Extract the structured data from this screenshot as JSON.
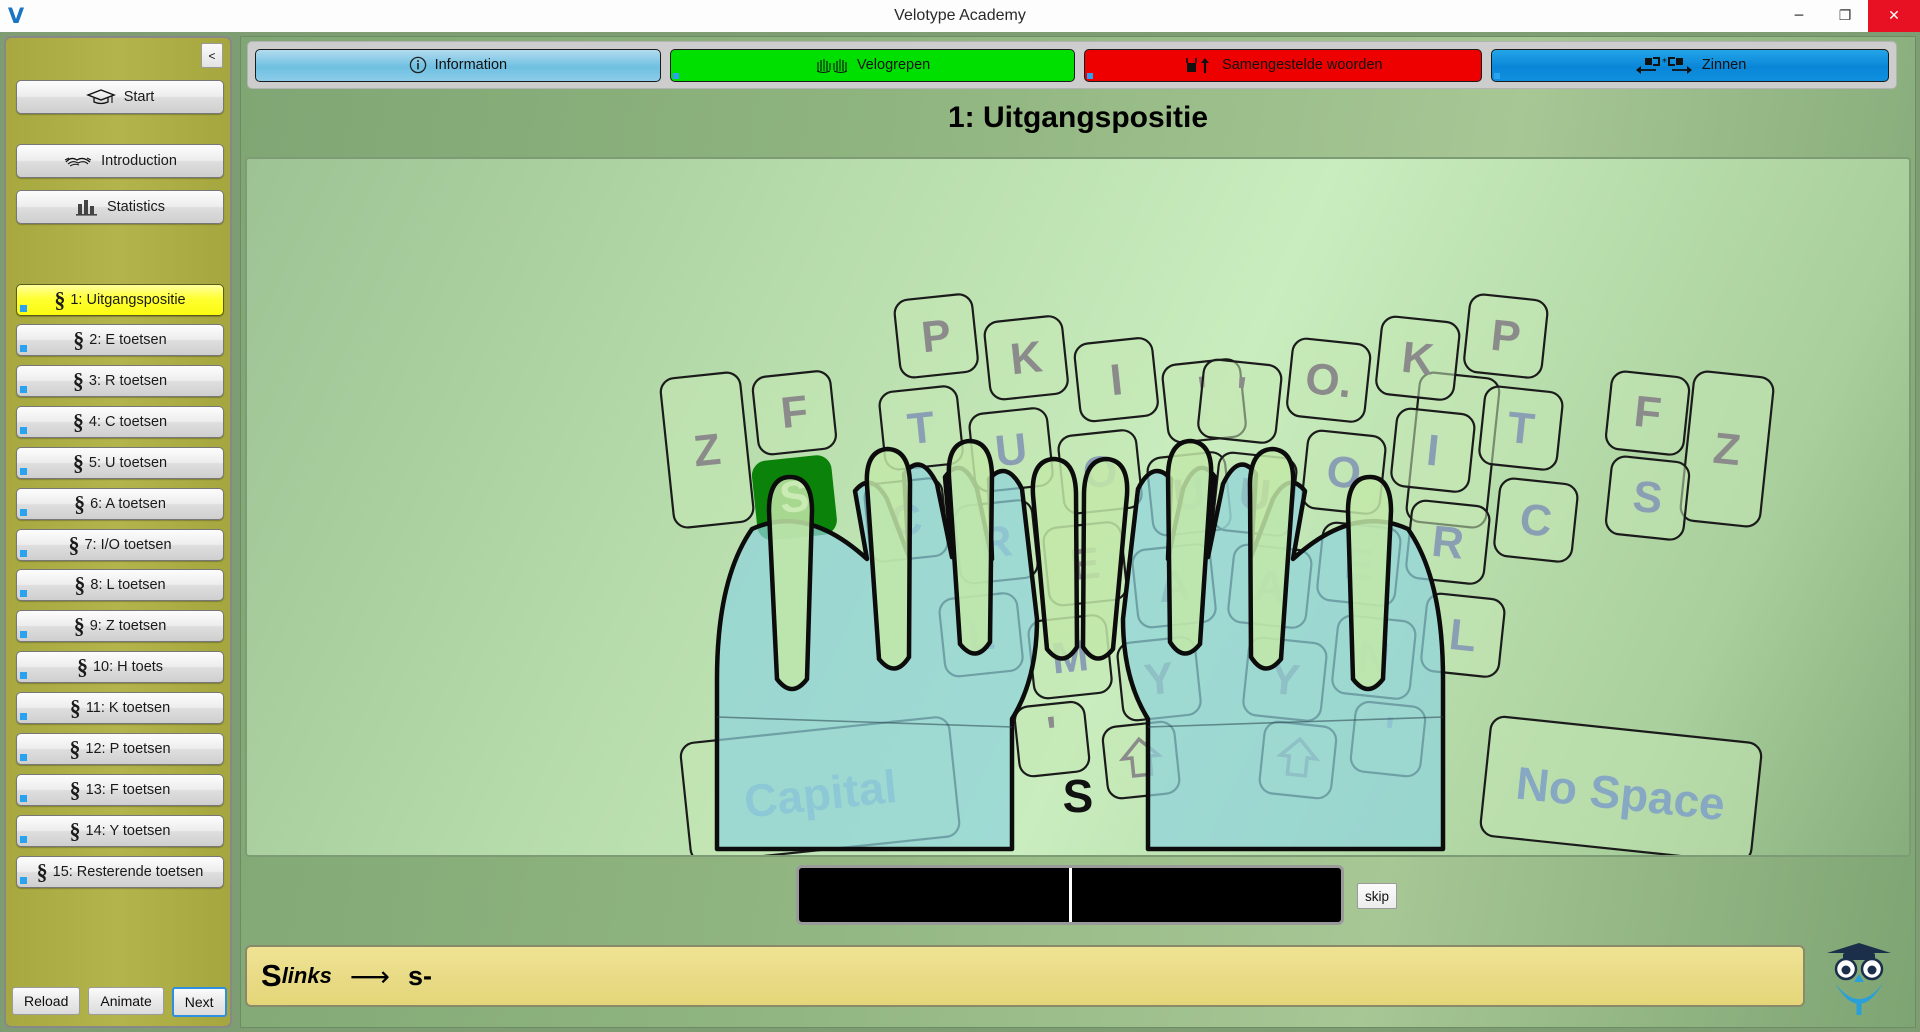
{
  "window": {
    "title": "Velotype Academy",
    "logo": "V",
    "minimize_glyph": "─",
    "maximize_glyph": "❐",
    "close_glyph": "✕"
  },
  "sidebar": {
    "collapse_label": "<",
    "top_items": [
      {
        "label": "Start",
        "icon": "graduation-cap-icon"
      },
      {
        "label": "Introduction",
        "icon": "handshake-icon"
      },
      {
        "label": "Statistics",
        "icon": "bar-chart-icon"
      }
    ],
    "lessons": [
      {
        "label": "1: Uitgangspositie",
        "active": true
      },
      {
        "label": "2: E toetsen",
        "active": false
      },
      {
        "label": "3: R toetsen",
        "active": false
      },
      {
        "label": "4: C toetsen",
        "active": false
      },
      {
        "label": "5: U toetsen",
        "active": false
      },
      {
        "label": "6: A toetsen",
        "active": false
      },
      {
        "label": "7: I/O toetsen",
        "active": false
      },
      {
        "label": "8: L toetsen",
        "active": false
      },
      {
        "label": "9: Z toetsen",
        "active": false
      },
      {
        "label": "10: H toets",
        "active": false
      },
      {
        "label": "11: K toetsen",
        "active": false
      },
      {
        "label": "12: P toetsen",
        "active": false
      },
      {
        "label": "13: F toetsen",
        "active": false
      },
      {
        "label": "14: Y toetsen",
        "active": false
      },
      {
        "label": "15: Resterende toetsen",
        "active": false
      }
    ],
    "section_symbol": "§",
    "footer_buttons": [
      {
        "label": "Reload",
        "focused": false
      },
      {
        "label": "Animate",
        "focused": false
      },
      {
        "label": "Next",
        "focused": true
      }
    ]
  },
  "toolbar": {
    "buttons": [
      {
        "label": "Information",
        "icon": "info-circle-icon",
        "color": "#8ccce8"
      },
      {
        "label": "Velogrepen",
        "icon": "hands-icon",
        "color": "#00e000"
      },
      {
        "label": "Samengestelde woorden",
        "icon": "word-arrow-icon",
        "color": "#ee0000"
      },
      {
        "label": "Zinnen",
        "icon": "sentence-arrows-icon",
        "color": "#0a86d8"
      }
    ]
  },
  "lesson": {
    "title": "1: Uitgangspositie",
    "target_letter": "S",
    "highlighted_key": "S",
    "highlight_color": "#0b8209"
  },
  "keyboard": {
    "left_keys": [
      "Z",
      "F",
      "S",
      "P",
      "K",
      "I",
      "'",
      "T",
      "U",
      "O",
      "U",
      "C",
      "R",
      "E",
      "A",
      "L",
      "M",
      "Y",
      "Capital"
    ],
    "right_keys": [
      "'",
      "O.",
      "K",
      "P",
      "U",
      "I",
      "T",
      "F",
      "Z",
      "A",
      "E",
      "R",
      "C",
      "Y",
      "N",
      "L",
      "No Space"
    ],
    "shift_glyph": "⇧",
    "capital_label": "Capital",
    "nospace_label": "No Space"
  },
  "input": {
    "left_value": "",
    "right_value": "",
    "skip_label": "skip"
  },
  "legend": {
    "main": "S",
    "sub": "links",
    "arrow": "⟶",
    "output": "s-"
  },
  "mascot": {
    "name": "owl-graduate-icon"
  }
}
